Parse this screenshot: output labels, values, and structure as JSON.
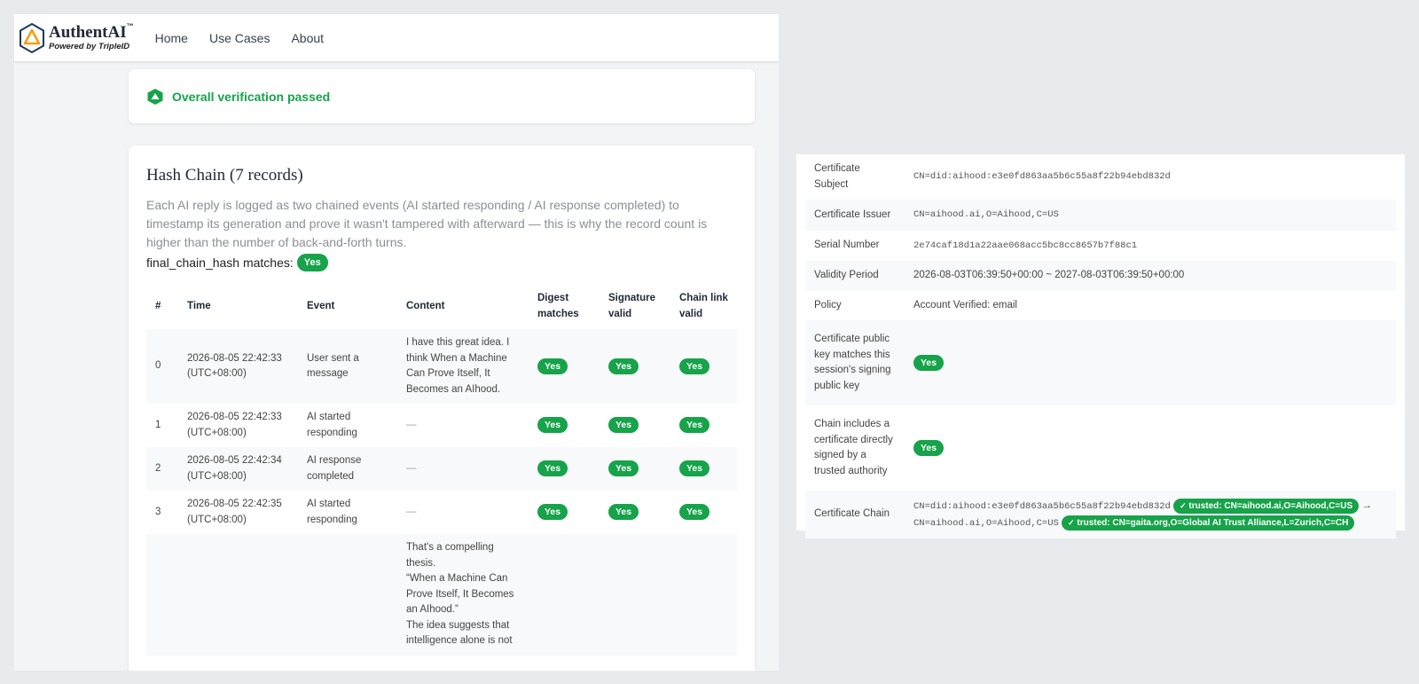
{
  "brand": {
    "name": "AuthentAI",
    "tm": "™",
    "sub": "Powered by TripleID"
  },
  "nav": [
    "Home",
    "Use Cases",
    "About"
  ],
  "status": {
    "text": "Overall verification passed"
  },
  "hash": {
    "title": "Hash Chain (7 records)",
    "description": "Each AI reply is logged as two chained events (AI started responding / AI response completed) to timestamp its generation and prove it wasn't tampered with afterward — this is why the record count is higher than the number of back-and-forth turns.",
    "match_label": "final_chain_hash matches:",
    "match_value": "Yes",
    "headers": [
      "#",
      "Time",
      "Event",
      "Content",
      "Digest matches",
      "Signature valid",
      "Chain link valid"
    ],
    "rows": [
      {
        "n": "0",
        "time": "2026-08-05 22:42:33 (UTC+08:00)",
        "event": "User sent a message",
        "content": "I have this great idea. I think When a Machine Can Prove Itself, It Becomes an AIhood.",
        "d": "Yes",
        "s": "Yes",
        "c": "Yes"
      },
      {
        "n": "1",
        "time": "2026-08-05 22:42:33 (UTC+08:00)",
        "event": "AI started responding",
        "content": "—",
        "d": "Yes",
        "s": "Yes",
        "c": "Yes"
      },
      {
        "n": "2",
        "time": "2026-08-05 22:42:34 (UTC+08:00)",
        "event": "AI response completed",
        "content": "—",
        "d": "Yes",
        "s": "Yes",
        "c": "Yes"
      },
      {
        "n": "3",
        "time": "2026-08-05 22:42:35 (UTC+08:00)",
        "event": "AI started responding",
        "content": "—",
        "d": "Yes",
        "s": "Yes",
        "c": "Yes"
      },
      {
        "n": "",
        "time": "",
        "event": "",
        "content": "That's a compelling thesis.\n“When a Machine Can Prove Itself, It Becomes an AIhood.”\nThe idea suggests that intelligence alone is not",
        "d": "",
        "s": "",
        "c": ""
      }
    ]
  },
  "cert": {
    "rows": [
      {
        "key": "Certificate Subject",
        "value": "CN=did:aihood:e3e0fd863aa5b6c55a8f22b94ebd832d",
        "type": "mono"
      },
      {
        "key": "Certificate Issuer",
        "value": "CN=aihood.ai,O=Aihood,C=US",
        "type": "mono"
      },
      {
        "key": "Serial Number",
        "value": "2e74caf18d1a22aae068acc5bc8cc8657b7f88c1",
        "type": "mono"
      },
      {
        "key": "Validity Period",
        "value": "2026-08-03T06:39:50+00:00 ~ 2027-08-03T06:39:50+00:00",
        "type": "text"
      },
      {
        "key": "Policy",
        "value": "Account Verified: email",
        "type": "text"
      },
      {
        "key": "Certificate public key matches this session's signing public key",
        "value": "Yes",
        "type": "pill"
      },
      {
        "key": "Chain includes a certificate directly signed by a trusted authority",
        "value": "Yes",
        "type": "pill"
      }
    ],
    "chain": {
      "key": "Certificate Chain",
      "subject": "CN=did:aihood:e3e0fd863aa5b6c55a8f22b94ebd832d",
      "trust1": "trusted: CN=aihood.ai,O=Aihood,C=US",
      "arrow": "→",
      "issuer": "CN=aihood.ai,O=Aihood,C=US",
      "trust2": "trusted: CN=gaita.org,O=Global AI Trust Alliance,L=Zurich,C=CH"
    }
  },
  "colors": {
    "success": "#16a34a",
    "accent_logo": "#f59e0b",
    "logo_outline": "#1e3a5f"
  }
}
